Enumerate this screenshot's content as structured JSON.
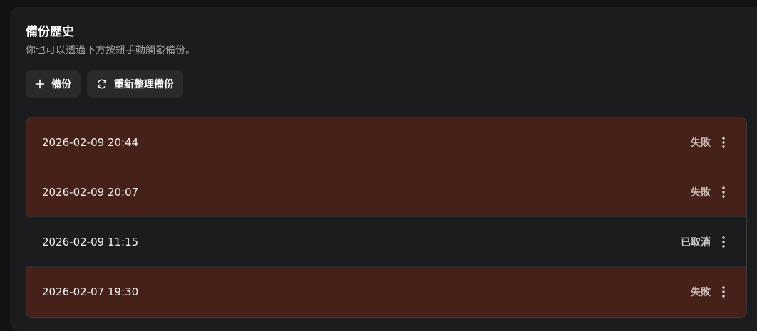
{
  "section": {
    "title": "備份歷史",
    "subtitle": "你也可以透過下方按鈕手動觸發備份。"
  },
  "actions": {
    "backup_label": "備份",
    "backup_icon": "plus-icon",
    "refresh_label": "重新整理備份",
    "refresh_icon": "refresh-icon"
  },
  "backups": [
    {
      "time": "2026-02-09 20:44",
      "status": "失敗",
      "state": "failed"
    },
    {
      "time": "2026-02-09 20:07",
      "status": "失敗",
      "state": "failed"
    },
    {
      "time": "2026-02-09 11:15",
      "status": "已取消",
      "state": "cancelled"
    },
    {
      "time": "2026-02-07 19:30",
      "status": "失敗",
      "state": "failed"
    }
  ],
  "colors": {
    "failed_row": "#46211a",
    "panel": "#1c1c1e",
    "button": "#2a2a2d"
  }
}
